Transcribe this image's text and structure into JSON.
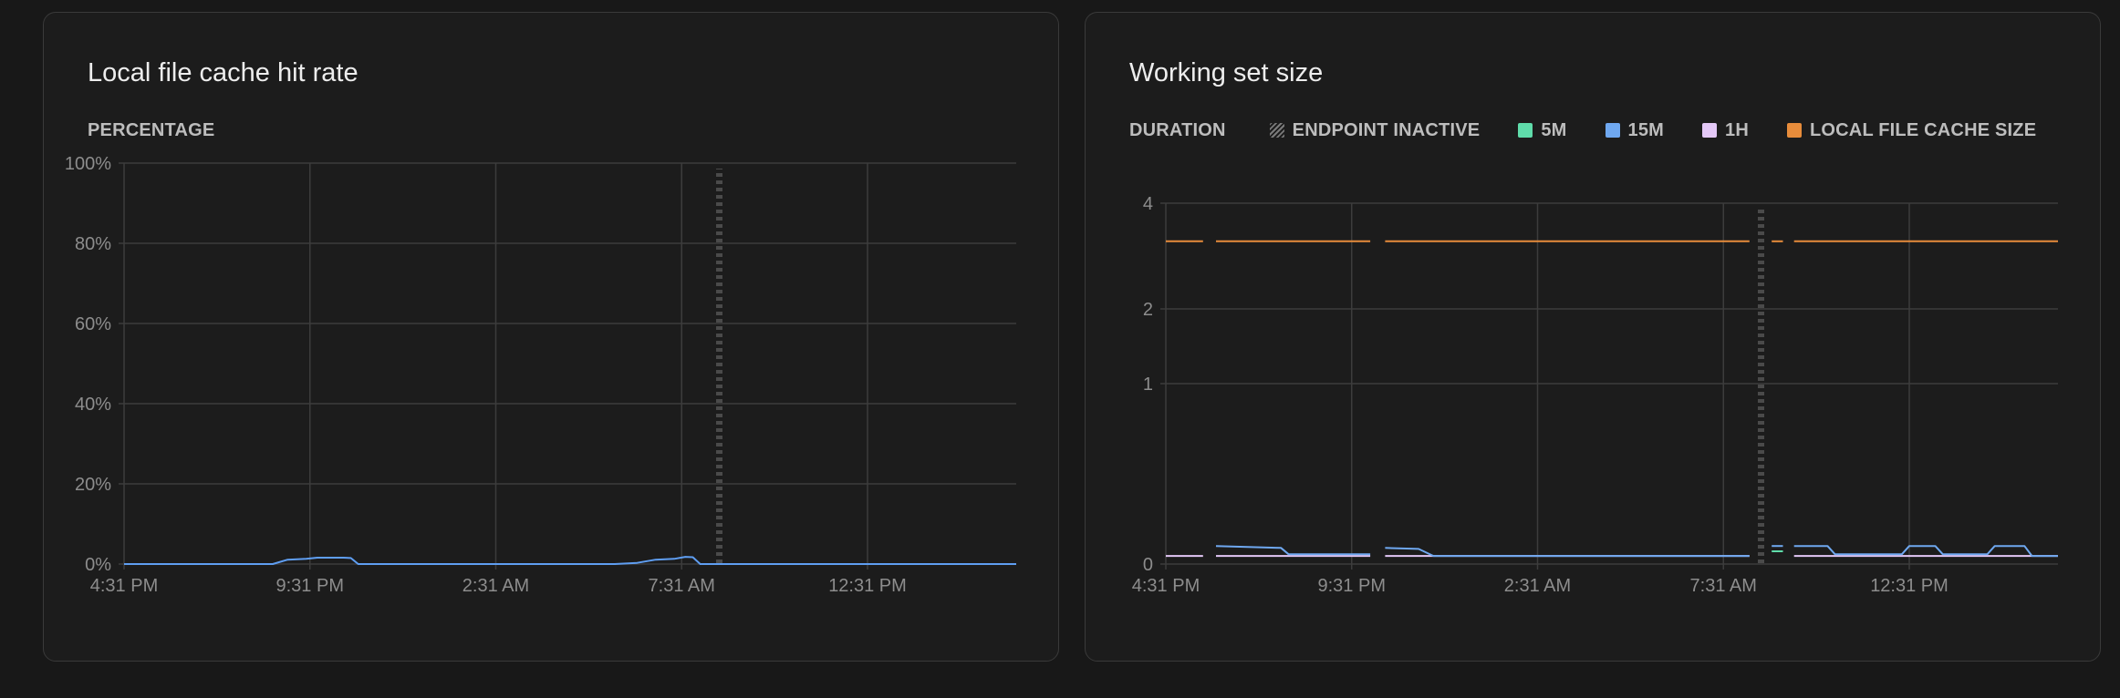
{
  "colors": {
    "grid": "#3c3c3c",
    "axis_text": "#8d8d8d",
    "inactive": "#4a4a4a",
    "blue": "#5f9ef2",
    "green": "#5fdcaa",
    "lightblue": "#6fa8f0",
    "lavender": "#e4c8f7",
    "orange": "#e78c3b"
  },
  "chart_data": [
    {
      "type": "line",
      "title": "Local file cache hit rate",
      "unit_label": "PERCENTAGE",
      "x_ticks": [
        "4:31 PM",
        "9:31 PM",
        "2:31 AM",
        "7:31 AM",
        "12:31 PM"
      ],
      "x_range": [
        0,
        24
      ],
      "y_ticks": [
        "0%",
        "20%",
        "40%",
        "60%",
        "80%",
        "100%"
      ],
      "y_tick_values": [
        0,
        20,
        40,
        60,
        80,
        100
      ],
      "ylim": [
        0,
        100
      ],
      "grid": true,
      "endpoint_inactive_at": 16,
      "series": [
        {
          "color": "blue",
          "points": [
            [
              0,
              0
            ],
            [
              4,
              0
            ],
            [
              4.4,
              1.1
            ],
            [
              4.9,
              1.3
            ],
            [
              5.2,
              1.6
            ],
            [
              5.9,
              1.6
            ],
            [
              6.1,
              1.5
            ],
            [
              6.3,
              0
            ],
            [
              13.2,
              0
            ],
            [
              13.8,
              0.3
            ],
            [
              14.3,
              1.1
            ],
            [
              14.8,
              1.3
            ],
            [
              15.1,
              1.8
            ],
            [
              15.3,
              1.7
            ],
            [
              15.5,
              0
            ],
            [
              24,
              0
            ]
          ]
        }
      ]
    },
    {
      "type": "line",
      "title": "Working set size",
      "unit_label": "DURATION",
      "legend": [
        {
          "label": "ENDPOINT INACTIVE",
          "swatch": "hatch"
        },
        {
          "label": "5M",
          "color": "green"
        },
        {
          "label": "15M",
          "color": "lightblue"
        },
        {
          "label": "1H",
          "color": "lavender"
        },
        {
          "label": "LOCAL FILE CACHE SIZE",
          "color": "orange"
        }
      ],
      "x_ticks": [
        "4:31 PM",
        "9:31 PM",
        "2:31 AM",
        "7:31 AM",
        "12:31 PM"
      ],
      "x_range": [
        0,
        24
      ],
      "y_ticks": [
        "0",
        "1",
        "2",
        "4"
      ],
      "y_tick_values": [
        0,
        1,
        2,
        4
      ],
      "y_scale": "sqrt",
      "ylim": [
        0,
        4
      ],
      "grid": true,
      "endpoint_inactive_at": 16,
      "series": [
        {
          "name": "LOCAL FILE CACHE SIZE",
          "color": "orange",
          "segments": [
            [
              [
                0,
                3.2
              ],
              [
                1,
                3.2
              ]
            ],
            [
              [
                1.35,
                3.2
              ],
              [
                5.5,
                3.2
              ]
            ],
            [
              [
                5.9,
                3.2
              ],
              [
                15.7,
                3.2
              ]
            ],
            [
              [
                16.3,
                3.2
              ],
              [
                16.6,
                3.2
              ]
            ],
            [
              [
                16.9,
                3.2
              ],
              [
                24,
                3.2
              ]
            ]
          ]
        },
        {
          "name": "1H",
          "color": "lavender",
          "segments": [
            [
              [
                0,
                0.002
              ],
              [
                1,
                0.002
              ]
            ],
            [
              [
                1.35,
                0.002
              ],
              [
                5.5,
                0.002
              ]
            ],
            [
              [
                5.9,
                0.002
              ],
              [
                15.7,
                0.002
              ]
            ],
            [
              [
                16.9,
                0.002
              ],
              [
                24,
                0.002
              ]
            ]
          ]
        },
        {
          "name": "15M",
          "color": "lightblue",
          "segments": [
            [
              [
                1.35,
                0.01
              ],
              [
                3.1,
                0.008
              ],
              [
                3.3,
                0.003
              ],
              [
                5.5,
                0.003
              ]
            ],
            [
              [
                5.9,
                0.008
              ],
              [
                6.8,
                0.007
              ],
              [
                7.2,
                0.002
              ],
              [
                15.7,
                0.002
              ]
            ],
            [
              [
                16.3,
                0.01
              ],
              [
                16.6,
                0.01
              ]
            ],
            [
              [
                16.9,
                0.01
              ],
              [
                17.8,
                0.01
              ],
              [
                18,
                0.003
              ],
              [
                19.8,
                0.003
              ],
              [
                20,
                0.01
              ],
              [
                20.7,
                0.01
              ],
              [
                20.9,
                0.003
              ],
              [
                22.1,
                0.003
              ],
              [
                22.3,
                0.01
              ],
              [
                23.1,
                0.01
              ],
              [
                23.3,
                0.002
              ],
              [
                24,
                0.002
              ]
            ]
          ]
        },
        {
          "name": "5M",
          "color": "green",
          "segments": [
            [
              [
                16.3,
                0.005
              ],
              [
                16.6,
                0.005
              ]
            ]
          ]
        }
      ]
    }
  ]
}
